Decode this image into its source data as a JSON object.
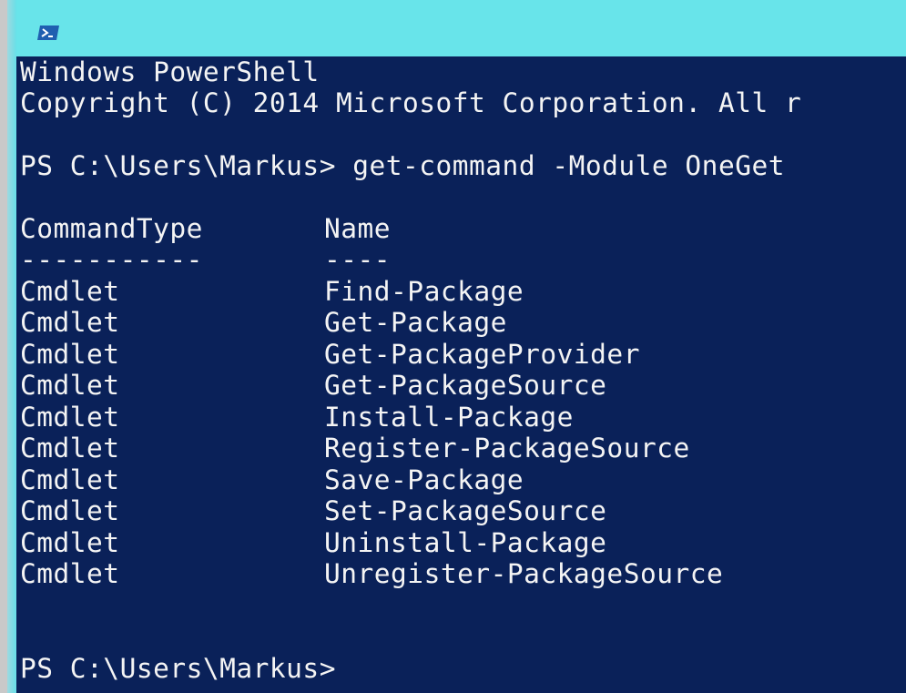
{
  "window": {
    "icon": "powershell-icon"
  },
  "console": {
    "header_line1": "Windows PowerShell",
    "header_line2": "Copyright (C) 2014 Microsoft Corporation. All r",
    "prompt_command": "PS C:\\Users\\Markus> get-command -Module OneGet",
    "table": {
      "col_type_header": "CommandType",
      "col_name_header": "Name",
      "col_type_sep": "-----------",
      "col_name_sep": "----",
      "rows": [
        {
          "type": "Cmdlet",
          "name": "Find-Package"
        },
        {
          "type": "Cmdlet",
          "name": "Get-Package"
        },
        {
          "type": "Cmdlet",
          "name": "Get-PackageProvider"
        },
        {
          "type": "Cmdlet",
          "name": "Get-PackageSource"
        },
        {
          "type": "Cmdlet",
          "name": "Install-Package"
        },
        {
          "type": "Cmdlet",
          "name": "Register-PackageSource"
        },
        {
          "type": "Cmdlet",
          "name": "Save-Package"
        },
        {
          "type": "Cmdlet",
          "name": "Set-PackageSource"
        },
        {
          "type": "Cmdlet",
          "name": "Uninstall-Package"
        },
        {
          "type": "Cmdlet",
          "name": "Unregister-PackageSource"
        }
      ]
    },
    "final_prompt": "PS C:\\Users\\Markus>"
  },
  "colors": {
    "titlebar": "#68e4ea",
    "console_bg": "#0a2159",
    "console_text": "#f4f4f4"
  }
}
